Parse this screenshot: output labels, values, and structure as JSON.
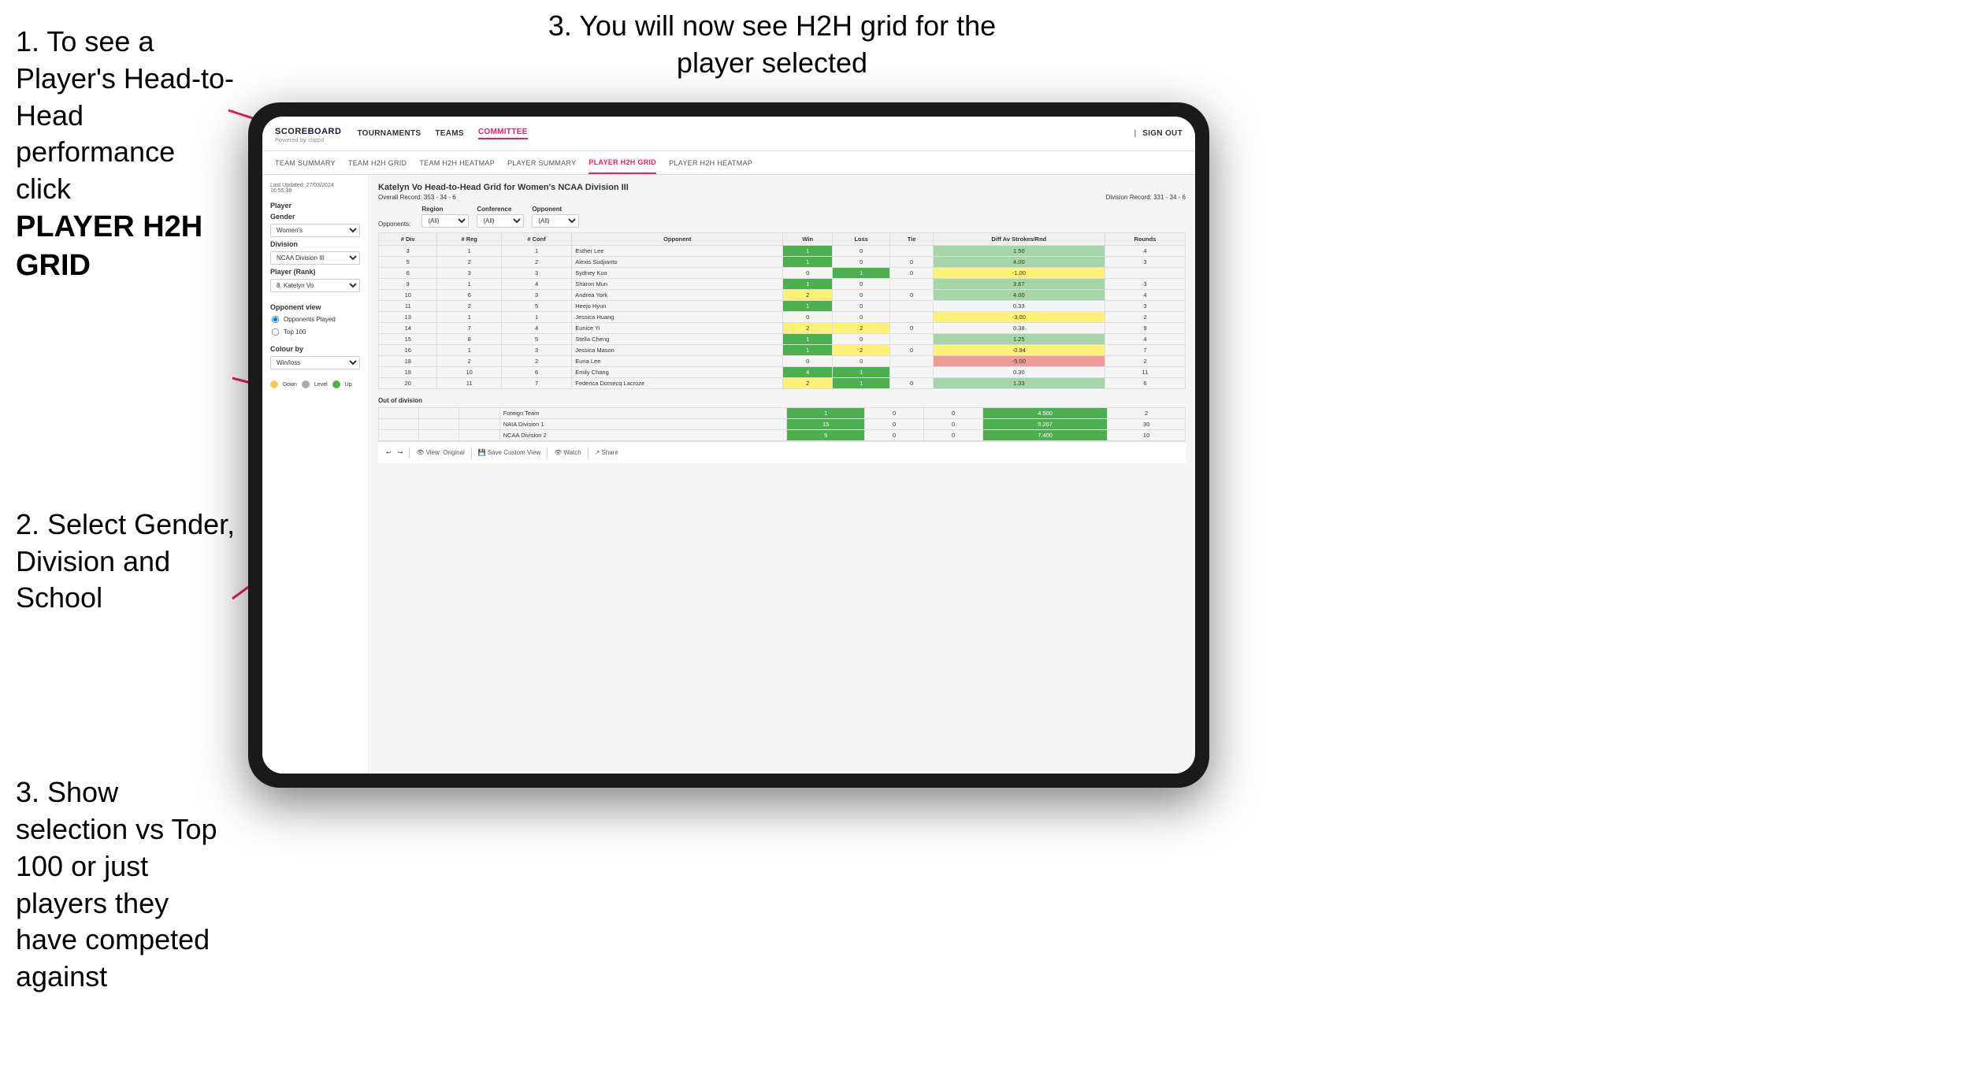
{
  "instructions": {
    "step1": {
      "text": "1. To see a Player's Head-to-Head performance click",
      "bold": "PLAYER H2H GRID"
    },
    "step2": {
      "text": "2. Select Gender, Division and School"
    },
    "step3_left": {
      "text": "3. Show selection vs Top 100 or just players they have competed against"
    },
    "step3_right": {
      "text": "3. You will now see H2H grid for the player selected"
    }
  },
  "app": {
    "logo": "SCOREBOARD",
    "logo_sub": "Powered by clippd",
    "nav": [
      "TOURNAMENTS",
      "TEAMS",
      "COMMITTEE"
    ],
    "sub_nav": [
      "TEAM SUMMARY",
      "TEAM H2H GRID",
      "TEAM H2H HEATMAP",
      "PLAYER SUMMARY",
      "PLAYER H2H GRID",
      "PLAYER H2H HEATMAP"
    ],
    "sign_out": "Sign out"
  },
  "sidebar": {
    "timestamp": "Last Updated: 27/03/2024\n16:55:38",
    "player_label": "Player",
    "gender_label": "Gender",
    "gender_value": "Women's",
    "division_label": "Division",
    "division_value": "NCAA Division III",
    "player_rank_label": "Player (Rank)",
    "player_rank_value": "8. Katelyn Vo",
    "opponent_view_label": "Opponent view",
    "opponent_played_label": "Opponents Played",
    "top_100_label": "Top 100",
    "colour_by_label": "Colour by",
    "colour_by_value": "Win/loss",
    "legend": {
      "down": "Down",
      "level": "Level",
      "up": "Up"
    }
  },
  "grid": {
    "title": "Katelyn Vo Head-to-Head Grid for Women's NCAA Division III",
    "overall_record_label": "Overall Record:",
    "overall_record": "353 - 34 - 6",
    "division_record_label": "Division Record:",
    "division_record": "331 - 34 - 6",
    "filters": {
      "opponents_label": "Opponents:",
      "region_label": "Region",
      "conference_label": "Conference",
      "opponent_label": "Opponent",
      "all_option": "(All)"
    },
    "table_headers": [
      "# Div",
      "# Reg",
      "# Conf",
      "Opponent",
      "Win",
      "Loss",
      "Tie",
      "Diff Av Strokes/Rnd",
      "Rounds"
    ],
    "rows": [
      {
        "div": "3",
        "reg": "1",
        "conf": "1",
        "opponent": "Esther Lee",
        "win": "1",
        "loss": "0",
        "tie": "",
        "diff": "1.50",
        "rounds": "4",
        "win_color": "green-dark",
        "loss_color": "",
        "diff_color": "green-light"
      },
      {
        "div": "5",
        "reg": "2",
        "conf": "2",
        "opponent": "Alexis Sudjianto",
        "win": "1",
        "loss": "0",
        "tie": "0",
        "diff": "4.00",
        "rounds": "3",
        "win_color": "green-dark",
        "loss_color": "",
        "diff_color": "green-light"
      },
      {
        "div": "6",
        "reg": "3",
        "conf": "3",
        "opponent": "Sydney Kuo",
        "win": "0",
        "loss": "1",
        "tie": "0",
        "diff": "-1.00",
        "rounds": "",
        "win_color": "",
        "loss_color": "green-dark",
        "diff_color": "yellow"
      },
      {
        "div": "9",
        "reg": "1",
        "conf": "4",
        "opponent": "Sharon Mun",
        "win": "1",
        "loss": "0",
        "tie": "",
        "diff": "3.67",
        "rounds": "3",
        "win_color": "green-dark",
        "loss_color": "",
        "diff_color": "green-light"
      },
      {
        "div": "10",
        "reg": "6",
        "conf": "3",
        "opponent": "Andrea York",
        "win": "2",
        "loss": "0",
        "tie": "0",
        "diff": "4.00",
        "rounds": "4",
        "win_color": "yellow",
        "loss_color": "",
        "diff_color": "green-light"
      },
      {
        "div": "11",
        "reg": "2",
        "conf": "5",
        "opponent": "Heejo Hyun",
        "win": "1",
        "loss": "0",
        "tie": "",
        "diff": "0.33",
        "rounds": "3",
        "win_color": "green-dark",
        "loss_color": "",
        "diff_color": ""
      },
      {
        "div": "13",
        "reg": "1",
        "conf": "1",
        "opponent": "Jessica Huang",
        "win": "0",
        "loss": "0",
        "tie": "",
        "diff": "-3.00",
        "rounds": "2",
        "win_color": "",
        "loss_color": "",
        "diff_color": "yellow"
      },
      {
        "div": "14",
        "reg": "7",
        "conf": "4",
        "opponent": "Eunice Yi",
        "win": "2",
        "loss": "2",
        "tie": "0",
        "diff": "0.38",
        "rounds": "9",
        "win_color": "yellow",
        "loss_color": "yellow",
        "diff_color": ""
      },
      {
        "div": "15",
        "reg": "8",
        "conf": "5",
        "opponent": "Stella Cheng",
        "win": "1",
        "loss": "0",
        "tie": "",
        "diff": "1.25",
        "rounds": "4",
        "win_color": "green-dark",
        "loss_color": "",
        "diff_color": "green-light"
      },
      {
        "div": "16",
        "reg": "1",
        "conf": "3",
        "opponent": "Jessica Mason",
        "win": "1",
        "loss": "2",
        "tie": "0",
        "diff": "-0.94",
        "rounds": "7",
        "win_color": "green-dark",
        "loss_color": "yellow",
        "diff_color": "yellow"
      },
      {
        "div": "18",
        "reg": "2",
        "conf": "2",
        "opponent": "Euna Lee",
        "win": "0",
        "loss": "0",
        "tie": "",
        "diff": "-5.00",
        "rounds": "2",
        "win_color": "",
        "loss_color": "",
        "diff_color": "red-light"
      },
      {
        "div": "19",
        "reg": "10",
        "conf": "6",
        "opponent": "Emily Chang",
        "win": "4",
        "loss": "1",
        "tie": "",
        "diff": "0.30",
        "rounds": "11",
        "win_color": "green-dark",
        "loss_color": "green-dark",
        "diff_color": ""
      },
      {
        "div": "20",
        "reg": "11",
        "conf": "7",
        "opponent": "Federica Domecq Lacroze",
        "win": "2",
        "loss": "1",
        "tie": "0",
        "diff": "1.33",
        "rounds": "6",
        "win_color": "yellow",
        "loss_color": "green-dark",
        "diff_color": "green-light"
      }
    ],
    "out_of_division": {
      "title": "Out of division",
      "rows": [
        {
          "opponent": "Foreign Team",
          "win": "1",
          "loss": "0",
          "tie": "0",
          "diff": "4.500",
          "rounds": "2",
          "win_color": "green-dark"
        },
        {
          "opponent": "NAIA Division 1",
          "win": "15",
          "loss": "0",
          "tie": "0",
          "diff": "9.267",
          "rounds": "30",
          "win_color": "green-dark"
        },
        {
          "opponent": "NCAA Division 2",
          "win": "5",
          "loss": "0",
          "tie": "0",
          "diff": "7.400",
          "rounds": "10",
          "win_color": "green-dark"
        }
      ]
    }
  },
  "toolbar": {
    "view_original": "View: Original",
    "save_custom": "Save Custom View",
    "watch": "Watch",
    "share": "Share"
  }
}
